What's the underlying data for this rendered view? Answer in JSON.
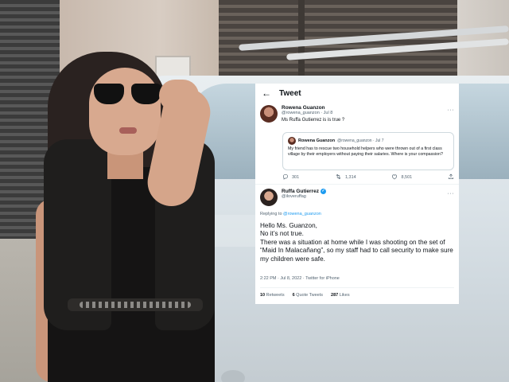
{
  "tweet": {
    "header": {
      "back_icon": "←",
      "title": "Tweet"
    },
    "original": {
      "name": "Rowena Guanzon",
      "handle_date": "@rowena_guanzon · Jul 8",
      "more": "···",
      "text": "Ms Ruffa Gutierrez is is true ?"
    },
    "quoted": {
      "name": "Rowena Guanzon",
      "handle_date": "@rowena_guanzon · Jul 7",
      "text": "My friend has to rescue two household helpers who were thrown out of a first class village by their employers without paying their salaries. Where is your compassion?"
    },
    "actions": {
      "replies": "301",
      "retweets": "1,314",
      "likes": "8,501"
    },
    "reply": {
      "name": "Ruffa Gutierrez",
      "handle": "@iloveruffag",
      "more": "···",
      "replying_prefix": "Replying to ",
      "replying_to": "@rowena_guanzon",
      "line1": "Hello Ms. Guanzon,",
      "line2": "No it’s not true.",
      "line3": "There was a situation at home while I was shooting on the set of “Maid In Malacañang”, so my staff had to call security to make sure my children were safe.",
      "meta": "2:22 PM · Jul 8, 2022 · Twitter for iPhone",
      "retweets_count": "10",
      "retweets_label": " Retweets",
      "quotes_count": "6",
      "quotes_label": " Quote Tweets",
      "likes_count": "287",
      "likes_label": " Likes"
    }
  },
  "icons": {
    "reply": "reply-icon",
    "retweet": "retweet-icon",
    "like": "heart-icon",
    "share": "share-icon",
    "verified": "verified-badge-icon"
  },
  "colors": {
    "accent": "#1d9bf0",
    "text": "#0f1419",
    "secondary": "#536471"
  }
}
